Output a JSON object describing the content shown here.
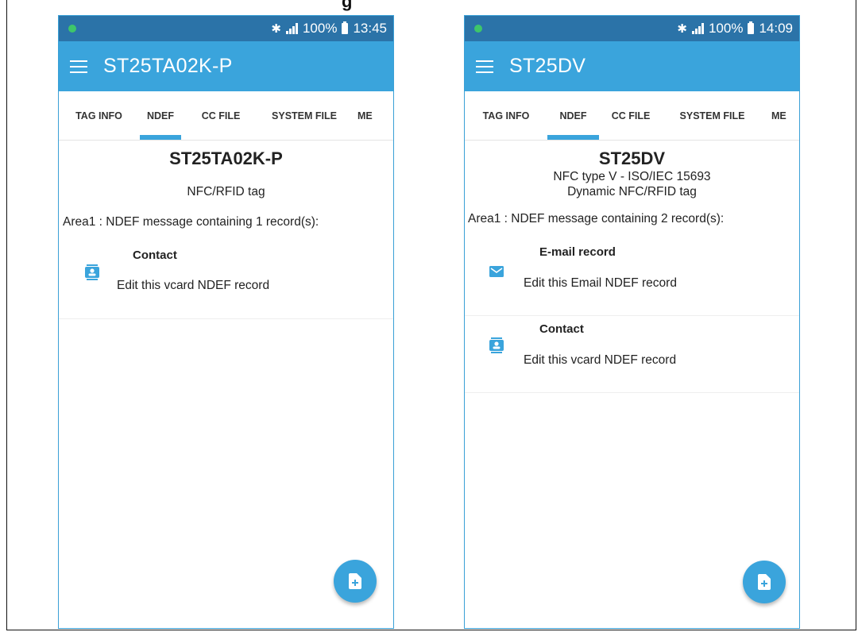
{
  "heading_fragment": "g",
  "phones": [
    {
      "status": {
        "signal": "✱ .ıl",
        "battery": "100%",
        "time": "13:45"
      },
      "app_title": "ST25TA02K-P",
      "tabs": [
        "TAG INFO",
        "NDEF",
        "CC FILE",
        "SYSTEM FILE",
        "ME"
      ],
      "active_tab": "NDEF",
      "tag_name": "ST25TA02K-P",
      "tag_lines": [
        "NFC/RFID tag"
      ],
      "area_text": "Area1 : NDEF message containing 1 record(s):",
      "records": [
        {
          "title": "Contact",
          "description": "Edit this vcard NDEF record",
          "icon": "contact-card-icon"
        }
      ],
      "fab_icon": "add-file-icon"
    },
    {
      "status": {
        "signal": "✱ .ıl",
        "battery": "100%",
        "time": "14:09"
      },
      "app_title": "ST25DV",
      "tabs": [
        "TAG INFO",
        "NDEF",
        "CC FILE",
        "SYSTEM FILE",
        "ME"
      ],
      "active_tab": "NDEF",
      "tag_name": "ST25DV",
      "tag_lines": [
        "NFC type V - ISO/IEC 15693",
        "Dynamic NFC/RFID tag"
      ],
      "area_text": "Area1 : NDEF message containing 2 record(s):",
      "records": [
        {
          "title": "E-mail record",
          "description": "Edit this Email NDEF record",
          "icon": "email-icon"
        },
        {
          "title": "Contact",
          "description": "Edit this vcard NDEF record",
          "icon": "contact-card-icon"
        }
      ],
      "fab_icon": "add-file-icon"
    }
  ],
  "colors": {
    "status_bar": "#2b73a8",
    "app_bar": "#3aa4dc",
    "accent": "#3aa4dc",
    "status_dot": "#3ec66a"
  }
}
